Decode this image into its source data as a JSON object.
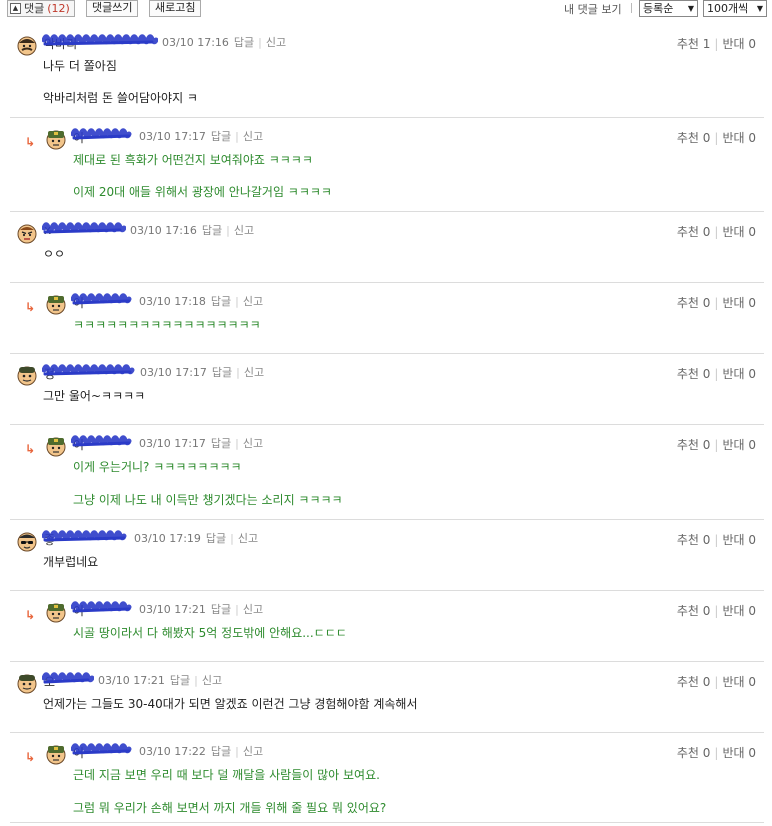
{
  "toolbar": {
    "comments_label": "댓글",
    "comments_count": "(12)",
    "write_label": "댓글쓰기",
    "refresh_label": "새로고침",
    "my_comments_label": "내 댓글 보기",
    "sort_value": "등록순",
    "per_page_value": "100개씩"
  },
  "labels": {
    "reply": "답글",
    "report": "신고",
    "recommend": "추천",
    "oppose": "반대"
  },
  "comments": [
    {
      "nick": "악바리",
      "time": "03/10 17:16",
      "rec": "1",
      "opp": "0",
      "lines": [
        "나두 더 쫄아짐",
        "악바리처럼 돈 쓸어담아야지 ㅋ"
      ]
    },
    {
      "nick": "이",
      "time": "03/10 17:17",
      "rec": "0",
      "opp": "0",
      "lines": [
        "제대로 된 흑화가 어떤건지 보여줘야죠 ㅋㅋㅋㅋ",
        "이제 20대 애들 위해서 광장에 안나갈거임 ㅋㅋㅋㅋ"
      ]
    },
    {
      "nick": "x",
      "time": "03/10 17:16",
      "rec": "0",
      "opp": "0",
      "lines": [
        "ㅇㅇ"
      ]
    },
    {
      "nick": "이",
      "time": "03/10 17:18",
      "rec": "0",
      "opp": "0",
      "lines": [
        "ㅋㅋㅋㅋㅋㅋㅋㅋㅋㅋㅋㅋㅋㅋㅋㅋㅋ"
      ]
    },
    {
      "nick": "정",
      "time": "03/10 17:17",
      "rec": "0",
      "opp": "0",
      "lines": [
        "그만 울어~ㅋㅋㅋㅋ"
      ]
    },
    {
      "nick": "이",
      "time": "03/10 17:17",
      "rec": "0",
      "opp": "0",
      "lines": [
        "이게 우는거니? ㅋㅋㅋㅋㅋㅋㅋㅋ",
        "그냥 이제 나도 내 이득만 챙기겠다는 소리지 ㅋㅋㅋㅋ"
      ]
    },
    {
      "nick": "좋",
      "time": "03/10 17:19",
      "rec": "0",
      "opp": "0",
      "lines": [
        "개부럽네요"
      ]
    },
    {
      "nick": "이",
      "time": "03/10 17:21",
      "rec": "0",
      "opp": "0",
      "lines": [
        "시골 땅이라서 다 해봤자 5억 정도밖에 안해요...ㄷㄷㄷ"
      ]
    },
    {
      "nick": "오",
      "time": "03/10 17:21",
      "rec": "0",
      "opp": "0",
      "lines": [
        "언제가는 그들도 30-40대가 되면 알겠죠 이런건 그냥 경험해야함 계속해서"
      ]
    },
    {
      "nick": "이",
      "time": "03/10 17:22",
      "rec": "0",
      "opp": "0",
      "lines": [
        "근데 지금 보면 우리 때 보다 덜 깨달을 사람들이 많아 보여요.",
        "그럼 뭐 우리가 손해 보면서 까지 개들 위해 줄 필요 뭐 있어요?"
      ]
    }
  ]
}
